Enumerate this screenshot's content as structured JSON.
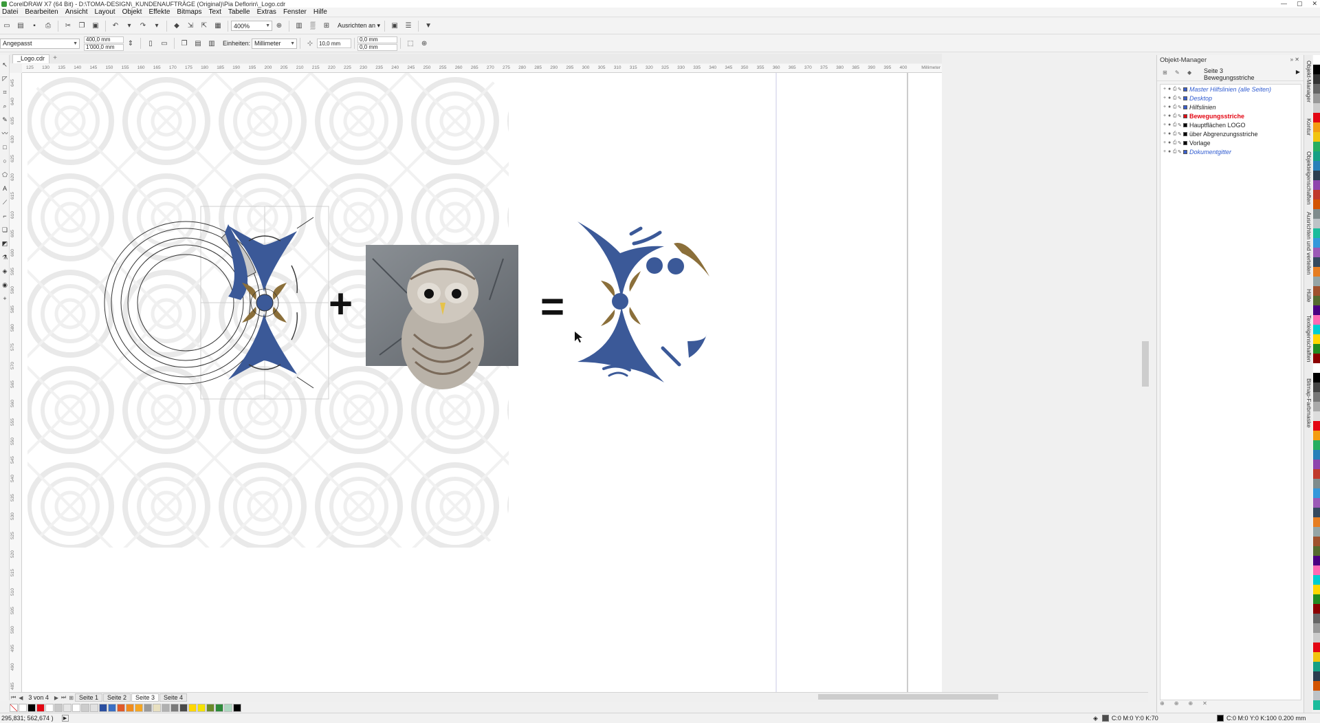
{
  "window": {
    "title": "CorelDRAW X7 (64 Bit) - D:\\TOMA-DESIGN\\_KUNDENAUFTRÄGE (Original)\\Pia Deflorin\\_Logo.cdr",
    "controls": [
      "—",
      "▢",
      "✕"
    ]
  },
  "menu": [
    "Datei",
    "Bearbeiten",
    "Ansicht",
    "Layout",
    "Objekt",
    "Effekte",
    "Bitmaps",
    "Text",
    "Tabelle",
    "Extras",
    "Fenster",
    "Hilfe"
  ],
  "toolbar1": {
    "zoom": "400%",
    "snap_label": "Ausrichten an"
  },
  "toolbar2": {
    "page_size": "Angepasst",
    "width": "400,0 mm",
    "height": "1'000,0 mm",
    "units_label": "Einheiten:",
    "units_value": "Millimeter",
    "nudge": "10,0 mm",
    "dup_x": "0,0 mm",
    "dup_y": "0,0 mm"
  },
  "document_tab": "_Logo.cdr",
  "ruler": {
    "unit": "Millimeter",
    "h_ticks": [
      "125",
      "130",
      "135",
      "140",
      "145",
      "150",
      "155",
      "160",
      "165",
      "170",
      "175",
      "180",
      "185",
      "190",
      "195",
      "200",
      "205",
      "210",
      "215",
      "220",
      "225",
      "230",
      "235",
      "240",
      "245",
      "250",
      "255",
      "260",
      "265",
      "270",
      "275",
      "280",
      "285",
      "290",
      "295",
      "300",
      "305",
      "310",
      "315",
      "320",
      "325",
      "330",
      "335",
      "340",
      "345",
      "350",
      "355",
      "360",
      "365",
      "370",
      "375",
      "380",
      "385",
      "390",
      "395",
      "400"
    ],
    "v_ticks": [
      "645",
      "640",
      "635",
      "630",
      "625",
      "620",
      "615",
      "610",
      "605",
      "600",
      "595",
      "590",
      "585",
      "580",
      "575",
      "570",
      "565",
      "560",
      "555",
      "550",
      "545",
      "540",
      "535",
      "530",
      "525",
      "520",
      "515",
      "510",
      "505",
      "500",
      "495",
      "490",
      "485"
    ]
  },
  "page_nav": {
    "count": "3 von 4",
    "pages": [
      "Seite 1",
      "Seite 2",
      "Seite 3",
      "Seite 4"
    ],
    "active_index": 2
  },
  "palette": [
    "#ffffff",
    "#000000",
    "#e30613",
    "#ffffff",
    "#c8c8c8",
    "#e6e6e6",
    "#ffffff",
    "#cccccc",
    "#e0e0e0",
    "#2b4fa0",
    "#3a6fc4",
    "#e05a2a",
    "#f08c1e",
    "#f5a623",
    "#9a9a9a",
    "#e8e0c0",
    "#b0b0b0",
    "#7a7a7a",
    "#4a4a4a",
    "#ffd700",
    "#f5e300",
    "#6a8a2a",
    "#2d8a3a",
    "#aed7c0",
    "#000000"
  ],
  "status": {
    "coords": "295,831; 562,674 )",
    "fill": "C:0 M:0 Y:0 K:70",
    "outline": "C:0 M:0 Y:0 K:100  0.200 mm"
  },
  "object_manager": {
    "title": "Objekt-Manager",
    "page": "Seite 3",
    "layer": "Bewegungsstriche",
    "layers": [
      {
        "name": "Master Hilfslinien (alle Seiten)",
        "color": "#3a5fcd",
        "style": "italic-blue"
      },
      {
        "name": "Desktop",
        "color": "#3a5fcd",
        "style": "italic-blue"
      },
      {
        "name": "Hilfslinien",
        "color": "#3a5fcd",
        "style": "italic"
      },
      {
        "name": "Bewegungsstriche",
        "color": "#e30613",
        "style": "bold-red"
      },
      {
        "name": "Hauptflächen LOGO",
        "color": "#000000",
        "style": "normal"
      },
      {
        "name": "über Abgrenzungsstriche",
        "color": "#000000",
        "style": "normal"
      },
      {
        "name": "Vorlage",
        "color": "#000000",
        "style": "normal"
      },
      {
        "name": "Dokumentgitter",
        "color": "#3a5fcd",
        "style": "italic-blue"
      }
    ]
  },
  "side_tabs": [
    "Objekt-Manager",
    "Kontur",
    "Objekteigenschaften",
    "Ausrichten und verteilen",
    "Hülle",
    "Texteigenschaften",
    "Bitmap-Farbmaske"
  ],
  "artwork": {
    "plus": "+",
    "equals": "=",
    "brand_blue": "#3b5998",
    "brand_gold": "#8b6f3a"
  }
}
